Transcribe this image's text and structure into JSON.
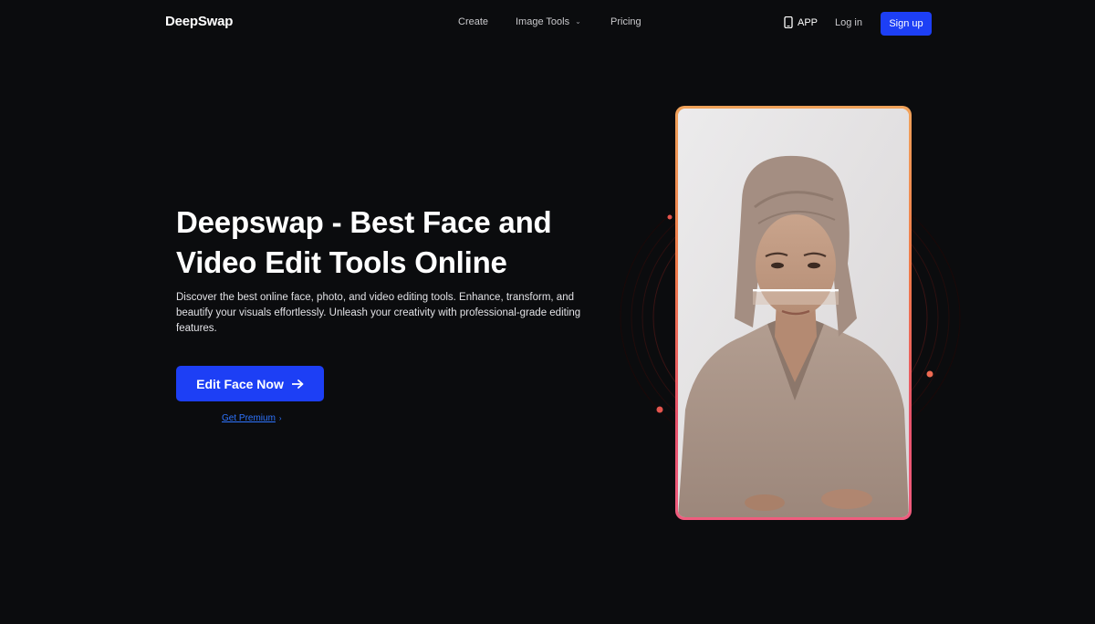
{
  "header": {
    "logo": "DeepSwap",
    "nav": {
      "create": "Create",
      "image_tools": "Image Tools",
      "pricing": "Pricing"
    },
    "app_label": "APP",
    "login_label": "Log in",
    "signup_label": "Sign up"
  },
  "hero": {
    "title_line1": "Deepswap - Best Face and",
    "title_line2": "Video Edit Tools Online",
    "description": "Discover the best online face, photo, and video editing tools. Enhance, transform, and beautify your visuals effortlessly. Unleash your creativity with professional-grade editing features.",
    "cta_label": "Edit Face Now",
    "premium_label": "Get Premium"
  },
  "icons": {
    "phone": "phone-icon",
    "arrow": "arrow-right-icon",
    "chevron": "chevron-down-icon"
  },
  "colors": {
    "accent": "#1d3ff5",
    "link": "#2e74ff",
    "background": "#0b0c0e",
    "frame_top": "#f0a25a",
    "frame_bottom": "#f05c7e"
  }
}
